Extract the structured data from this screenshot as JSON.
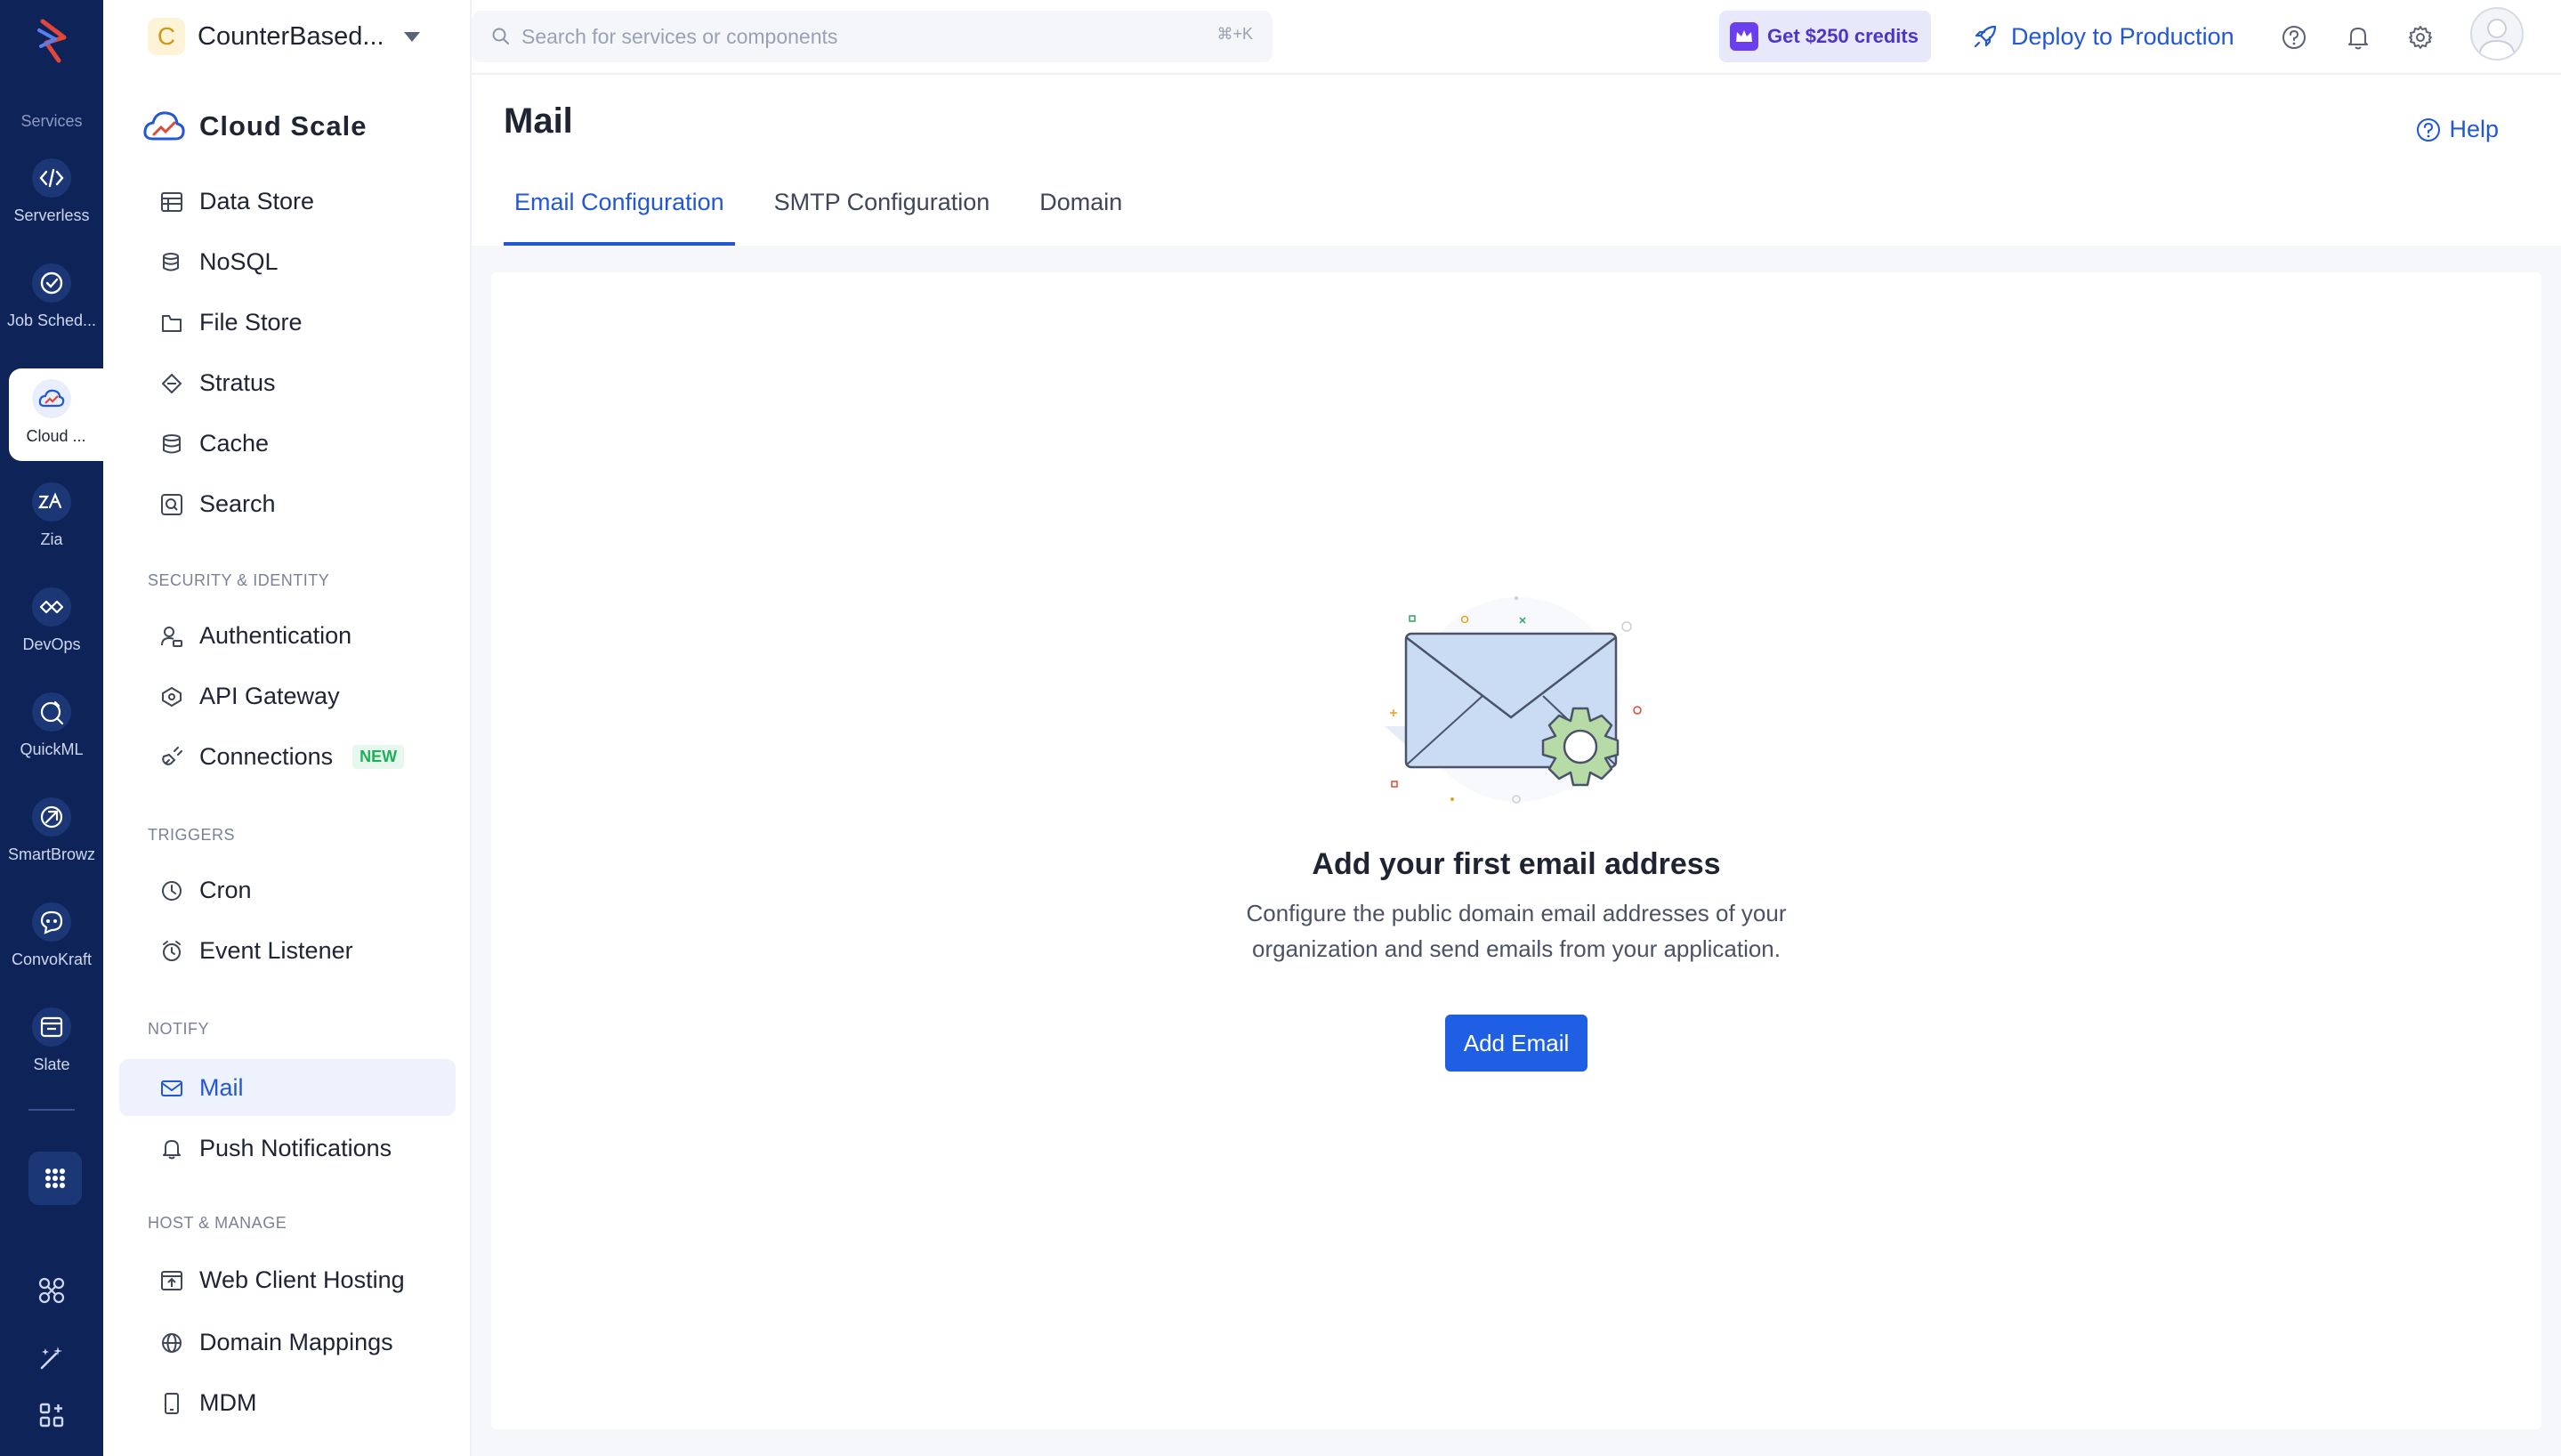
{
  "rail": {
    "services_label": "Services",
    "items": [
      {
        "label": "Serverless"
      },
      {
        "label": "Job Sched..."
      },
      {
        "label": "Cloud ..."
      },
      {
        "label": "Zia"
      },
      {
        "label": "DevOps"
      },
      {
        "label": "QuickML"
      },
      {
        "label": "SmartBrowz"
      },
      {
        "label": "ConvoKraft"
      },
      {
        "label": "Slate"
      }
    ]
  },
  "project": {
    "initial": "C",
    "name": "CounterBased..."
  },
  "brand": {
    "title": "Cloud Scale"
  },
  "sidebar": {
    "items": [
      {
        "label": "Data Store"
      },
      {
        "label": "NoSQL"
      },
      {
        "label": "File Store"
      },
      {
        "label": "Stratus"
      },
      {
        "label": "Cache"
      },
      {
        "label": "Search"
      }
    ],
    "security": {
      "title": "SECURITY & IDENTITY",
      "items": [
        {
          "label": "Authentication"
        },
        {
          "label": "API Gateway"
        },
        {
          "label": "Connections",
          "badge": "NEW"
        }
      ]
    },
    "triggers": {
      "title": "TRIGGERS",
      "items": [
        {
          "label": "Cron"
        },
        {
          "label": "Event Listener"
        }
      ]
    },
    "notify": {
      "title": "NOTIFY",
      "items": [
        {
          "label": "Mail"
        },
        {
          "label": "Push Notifications"
        }
      ]
    },
    "host": {
      "title": "HOST & MANAGE",
      "items": [
        {
          "label": "Web Client Hosting"
        },
        {
          "label": "Domain Mappings"
        },
        {
          "label": "MDM"
        }
      ]
    }
  },
  "topbar": {
    "search_placeholder": "Search for services or components",
    "search_shortcut": "⌘+K",
    "credits_label": "Get $250 credits",
    "deploy_label": "Deploy to Production"
  },
  "page": {
    "title": "Mail",
    "help_label": "Help",
    "tabs": [
      {
        "label": "Email Configuration"
      },
      {
        "label": "SMTP Configuration"
      },
      {
        "label": "Domain"
      }
    ],
    "empty": {
      "title": "Add your first email address",
      "description": "Configure the public domain email addresses of your organization and send emails from your application.",
      "button_label": "Add Email"
    }
  },
  "colors": {
    "rail_bg": "#0e2459",
    "accent": "#2257d6",
    "button": "#1f5fe4",
    "credits_bg": "#e8e8fb",
    "new_badge": "#1fb057"
  }
}
